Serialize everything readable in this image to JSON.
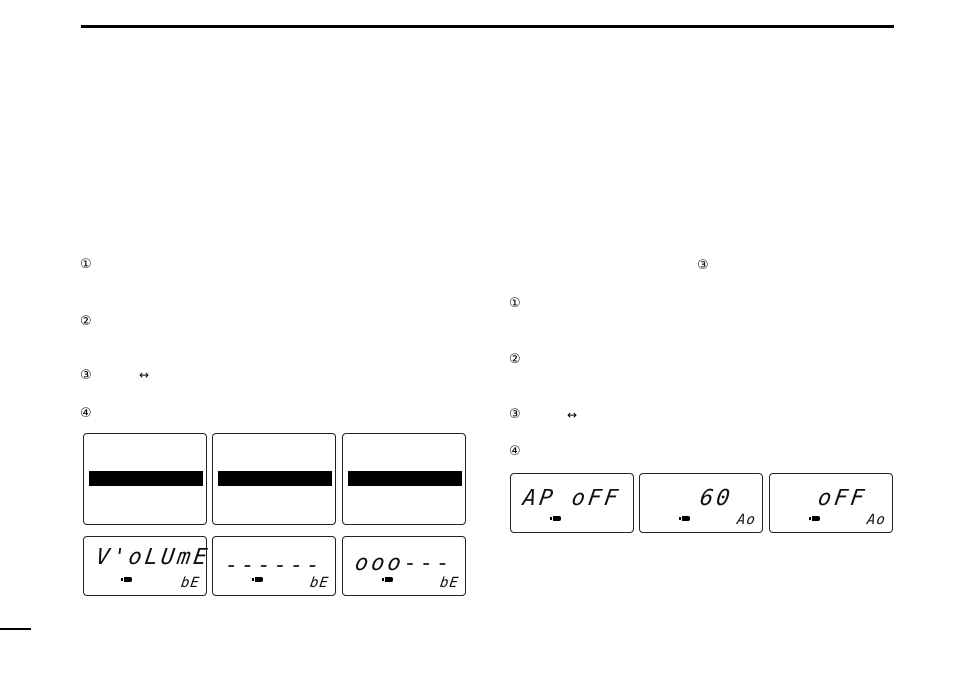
{
  "page": {
    "left_column": {
      "steps": [
        {
          "marker": "①"
        },
        {
          "marker": "②"
        },
        {
          "marker": "③",
          "arrow": "↔"
        },
        {
          "marker": "④"
        }
      ],
      "displays_top": [
        {
          "type": "highlight-bar"
        },
        {
          "type": "highlight-bar"
        },
        {
          "type": "highlight-bar"
        }
      ],
      "displays_bottom": [
        {
          "main": "V'oLUmE",
          "sub": "bE",
          "battery": "battery-icon"
        },
        {
          "main": "------",
          "sub": "bE",
          "battery": "battery-icon"
        },
        {
          "main": "ooo---",
          "sub": "bE",
          "battery": "battery-icon"
        }
      ]
    },
    "right_column": {
      "reference_marker": "③",
      "steps": [
        {
          "marker": "①"
        },
        {
          "marker": "②"
        },
        {
          "marker": "③",
          "arrow": "↔"
        },
        {
          "marker": "④"
        }
      ],
      "displays": [
        {
          "main": "AP oFF",
          "sub": "",
          "battery": "battery-icon"
        },
        {
          "main": "60",
          "sub": "Ao",
          "battery": "battery-icon"
        },
        {
          "main": "oFF",
          "sub": "Ao",
          "battery": "battery-icon"
        }
      ]
    }
  }
}
